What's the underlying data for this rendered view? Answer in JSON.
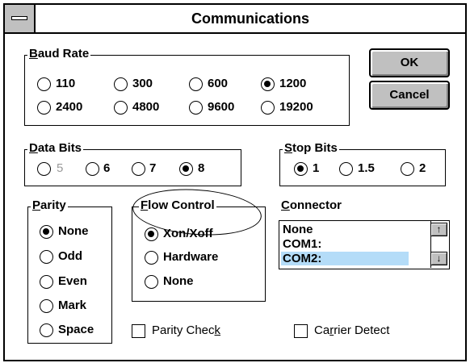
{
  "dialog": {
    "title": "Communications",
    "ok_label": "OK",
    "cancel_label": "Cancel"
  },
  "baud_rate": {
    "label_accel": "B",
    "label_rest": "aud Rate",
    "options": [
      "110",
      "300",
      "600",
      "1200",
      "2400",
      "4800",
      "9600",
      "19200"
    ],
    "selected": "1200"
  },
  "data_bits": {
    "label_accel": "D",
    "label_rest": "ata Bits",
    "options": [
      "5",
      "6",
      "7",
      "8"
    ],
    "disabled": [
      "5"
    ],
    "selected": "8"
  },
  "stop_bits": {
    "label_accel": "S",
    "label_rest": "top Bits",
    "options": [
      "1",
      "1.5",
      "2"
    ],
    "selected": "1"
  },
  "parity": {
    "label_accel": "P",
    "label_rest": "arity",
    "options": [
      "None",
      "Odd",
      "Even",
      "Mark",
      "Space"
    ],
    "selected": "None"
  },
  "flow_control": {
    "label_accel": "F",
    "label_rest": "low Control",
    "options": [
      "Xon/Xoff",
      "Hardware",
      "None"
    ],
    "selected": "Xon/Xoff",
    "highlight": "ellipse"
  },
  "connector": {
    "label_accel": "C",
    "label_rest": "onnector",
    "items": [
      "None",
      "COM1:",
      "COM2:"
    ],
    "selected": "COM2:",
    "scroll_up_glyph": "↑",
    "scroll_down_glyph": "↓"
  },
  "checkboxes": {
    "parity_check": {
      "pre": "Parity Chec",
      "accel": "k",
      "post": "",
      "checked": false
    },
    "carrier_detect": {
      "pre": "Ca",
      "accel": "r",
      "post": "rier Detect",
      "checked": false
    }
  }
}
